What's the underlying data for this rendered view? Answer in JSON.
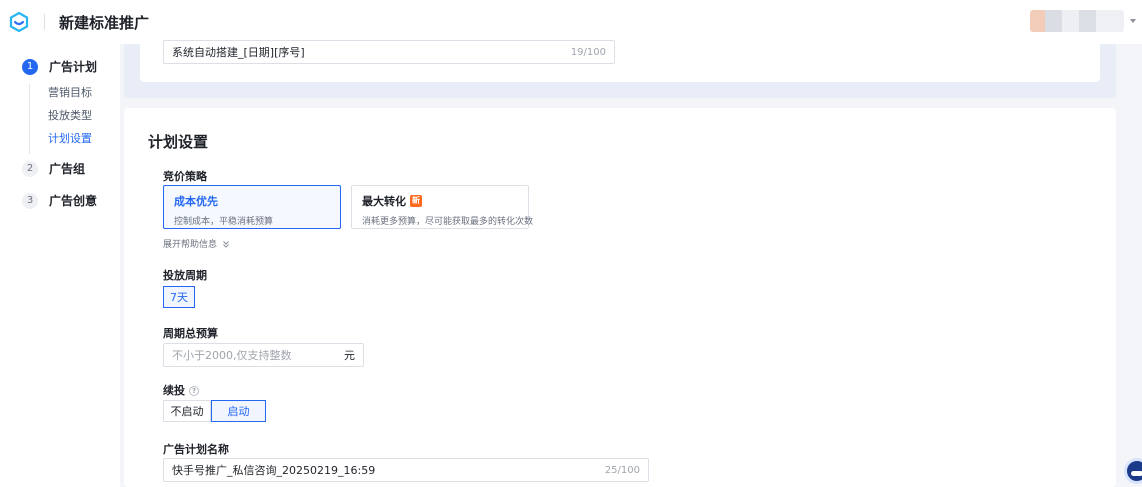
{
  "header": {
    "title": "新建标准推广",
    "logo_icon": "logo-icon",
    "avatar_icon": "avatar-icon"
  },
  "sidebar": {
    "steps": [
      {
        "num": "1",
        "label": "广告计划",
        "active": true
      },
      {
        "num": "2",
        "label": "广告组",
        "active": false
      },
      {
        "num": "3",
        "label": "广告创意",
        "active": false
      }
    ],
    "substeps": [
      {
        "label": "营销目标"
      },
      {
        "label": "投放类型"
      },
      {
        "label": "计划设置",
        "active": true
      }
    ]
  },
  "top_card": {
    "name_value": "系统自动搭建_[日期][序号]",
    "name_count": "19/100"
  },
  "plan_settings": {
    "title": "计划设置",
    "bid_strategy": {
      "label": "竞价策略",
      "options": [
        {
          "title": "成本优先",
          "desc": "控制成本，平稳消耗预算",
          "selected": true
        },
        {
          "title": "最大转化",
          "badge": "新",
          "desc": "消耗更多预算，尽可能获取最多的转化次数",
          "selected": false
        }
      ],
      "help_link": "展开帮助信息"
    },
    "period": {
      "label": "投放周期",
      "value": "7天"
    },
    "budget": {
      "label": "周期总预算",
      "placeholder": "不小于2000,仅支持整数",
      "unit": "元"
    },
    "renew": {
      "label": "续投",
      "options": [
        "不启动",
        "启动"
      ],
      "selected": "启动"
    },
    "plan_name": {
      "label": "广告计划名称",
      "value": "快手号推广_私信咨询_20250219_16:59",
      "count": "25/100"
    }
  },
  "colors": {
    "accent": "#2468f2",
    "badge": "#ff6a1f"
  }
}
